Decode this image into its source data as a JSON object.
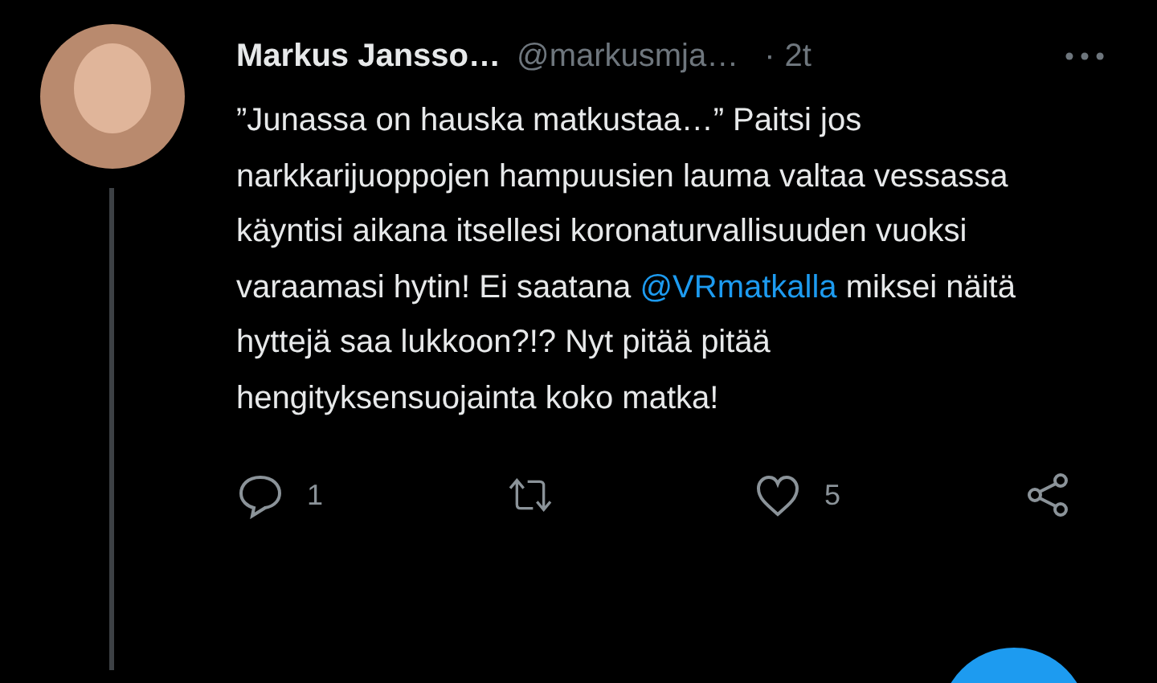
{
  "tweet": {
    "author_name": "Markus Jansso…",
    "handle": "@markusmja…",
    "separator": "·",
    "time": "2t",
    "body": {
      "before": "”Junassa on hauska matkustaa…” Paitsi jos narkkarijuoppojen hampuusien lauma valtaa vessassa käyntisi aikana itsellesi koronaturvallisuuden vuoksi varaamasi hytin! Ei saatana ",
      "mention": "@VRmatkalla",
      "after": " miksei näitä hyttejä saa lukkoon?!? Nyt pitää pitää hengityksensuojainta koko matka!"
    },
    "actions": [
      {
        "kind": "reply",
        "count": "1"
      },
      {
        "kind": "retweet"
      },
      {
        "kind": "like",
        "count": "5"
      },
      {
        "kind": "share"
      }
    ]
  }
}
